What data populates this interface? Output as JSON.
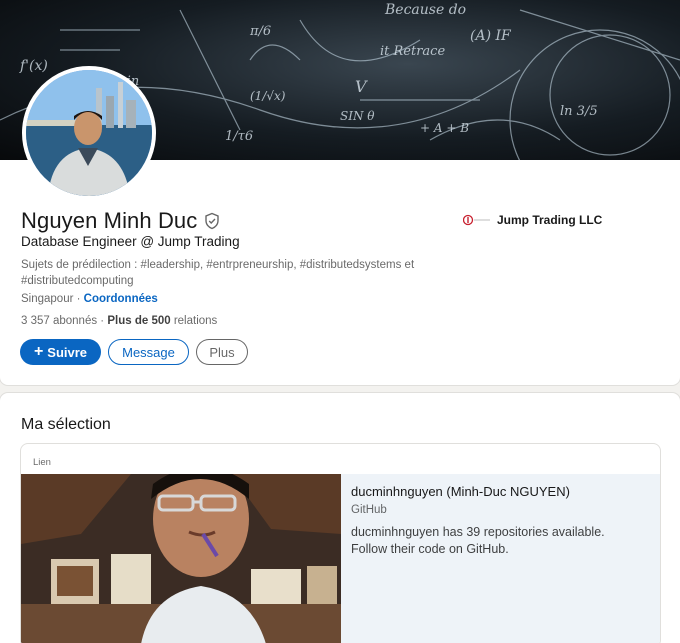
{
  "profile": {
    "name": "Nguyen Minh Duc",
    "headline": "Database Engineer @ Jump Trading",
    "topics": "Sujets de prédilection : #leadership, #entrpreneurship, #distributedsystems et #distributedcomputing",
    "location": "Singapour",
    "location_sep": " · ",
    "contact_link": "Coordonnées",
    "followers": "3 357 abonnés",
    "stats_sep": " · ",
    "connections_bold": "Plus de 500",
    "connections_suffix": " relations",
    "company": "Jump Trading LLC",
    "actions": {
      "follow_icon": "+",
      "follow": "Suivre",
      "message": "Message",
      "more": "Plus"
    }
  },
  "banner": {
    "texts": [
      "Because do",
      "(A) IF",
      "it Retrace",
      "sin",
      "SIN θ",
      "+ A + B",
      "V",
      "f'(x)",
      "ln 3/5",
      "1/τ6",
      "(1/√x)",
      "π/6"
    ]
  },
  "featured": {
    "title": "Ma sélection",
    "item": {
      "type": "Lien",
      "title": "ducminhnguyen (Minh-Duc NGUYEN)",
      "source": "GitHub",
      "description": "ducminhnguyen has 39 repositories available. Follow their code on GitHub."
    }
  },
  "colors": {
    "primary": "#0a66c2",
    "background": "#f3f2ef",
    "item_body_bg": "#eef3f8"
  },
  "icons": {
    "verified": "verified-shield-icon",
    "company": "jump-trading-logo"
  }
}
